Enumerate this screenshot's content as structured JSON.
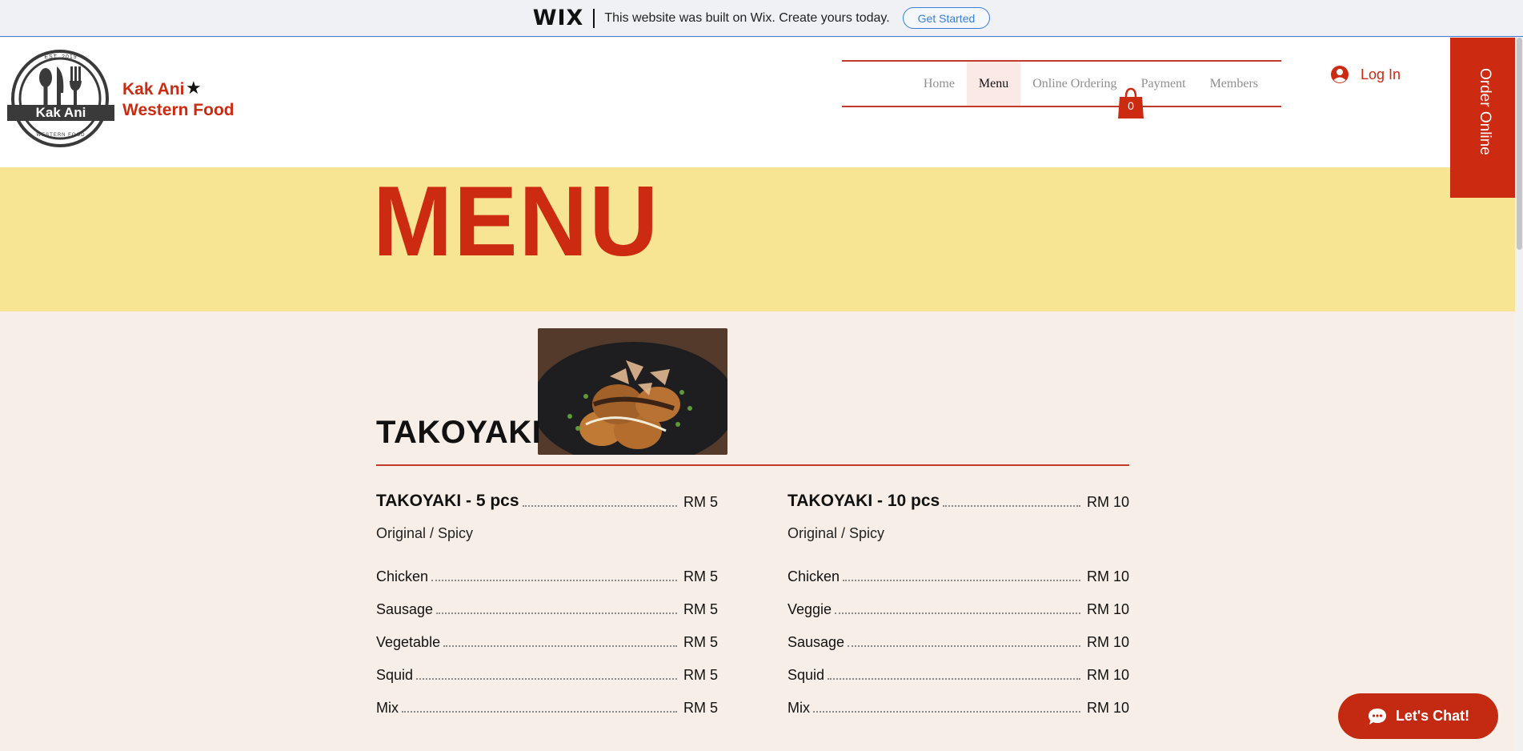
{
  "wix_banner": {
    "logo": "WIX",
    "text": "This website was built on Wix. Create yours today.",
    "button": "Get Started"
  },
  "header": {
    "logo_top_text": "EST. 2019",
    "logo_name": "Kak Ani",
    "logo_bottom_text": "WESTERN FOOD",
    "brand_line1": "Kak Ani",
    "brand_line2": "Western Food",
    "brand_star": "★",
    "nav": [
      "Home",
      "Menu",
      "Online Ordering",
      "Payment",
      "Members"
    ],
    "nav_active": "Menu",
    "cart_count": "0",
    "login": "Log In",
    "order_online": "Order Online"
  },
  "hero": {
    "title": "MENU"
  },
  "menu": {
    "category": "TAKOYAKI",
    "left": {
      "title": "TAKOYAKI - 5 pcs",
      "title_price": "RM 5",
      "subtitle": "Original / Spicy",
      "items": [
        {
          "name": "Chicken",
          "price": "RM 5"
        },
        {
          "name": "Sausage",
          "price": "RM 5"
        },
        {
          "name": "Vegetable",
          "price": "RM 5"
        },
        {
          "name": "Squid",
          "price": "RM 5"
        },
        {
          "name": "Mix",
          "price": "RM 5"
        }
      ]
    },
    "right": {
      "title": "TAKOYAKI - 10 pcs",
      "title_price": "RM 10",
      "subtitle": "Original / Spicy",
      "items": [
        {
          "name": "Chicken",
          "price": "RM 10"
        },
        {
          "name": "Veggie",
          "price": "RM 10"
        },
        {
          "name": "Sausage",
          "price": "RM 10"
        },
        {
          "name": "Squid",
          "price": "RM 10"
        },
        {
          "name": "Mix",
          "price": "RM 10"
        }
      ]
    }
  },
  "chat": {
    "label": "Let's Chat!"
  },
  "colors": {
    "brand_red": "#cc2b11",
    "hero_yellow": "#f8e593",
    "section_bg": "#f7efe7",
    "wix_blue": "#3b7ddd"
  }
}
